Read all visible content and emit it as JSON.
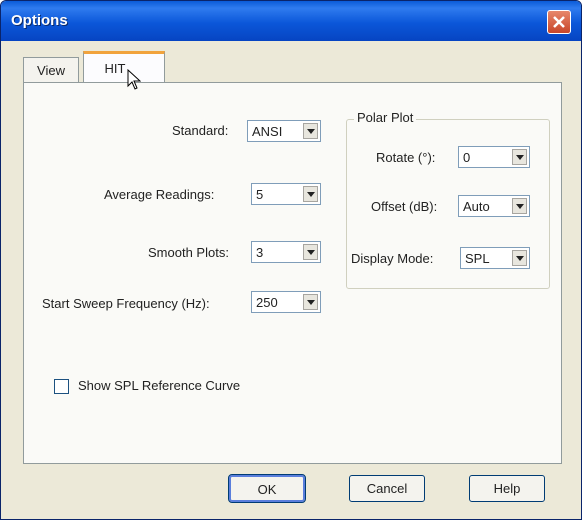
{
  "window": {
    "title": "Options"
  },
  "tabs": [
    {
      "label": "View"
    },
    {
      "label": "HIT"
    }
  ],
  "hit": {
    "standard": {
      "label": "Standard:",
      "value": "ANSI"
    },
    "average_readings": {
      "label": "Average Readings:",
      "value": "5"
    },
    "smooth_plots": {
      "label": "Smooth Plots:",
      "value": "3"
    },
    "start_sweep_frequency": {
      "label": "Start Sweep Frequency (Hz):",
      "value": "250"
    },
    "polar_plot": {
      "title": "Polar Plot",
      "rotate": {
        "label": "Rotate (°):",
        "value": "0"
      },
      "offset": {
        "label": "Offset (dB):",
        "value": "Auto"
      },
      "display_mode": {
        "label": "Display Mode:",
        "value": "SPL"
      }
    },
    "show_spl_reference_curve": {
      "label": "Show SPL Reference Curve",
      "checked": false
    }
  },
  "buttons": {
    "ok": "OK",
    "cancel": "Cancel",
    "help": "Help"
  },
  "colors": {
    "titlebar": "#0A5BD8",
    "close": "#C8452A",
    "tab_highlight": "#F1A33C",
    "dialog_bg": "#ECE9D8"
  },
  "icons": {
    "close": "close-icon",
    "dropdown": "chevron-down-icon",
    "cursor": "mouse-pointer-icon"
  }
}
